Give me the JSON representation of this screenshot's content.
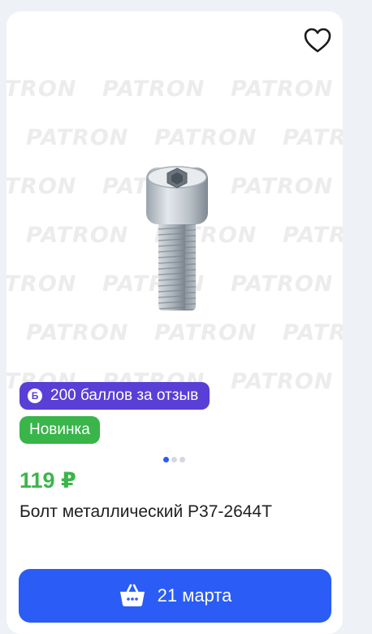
{
  "product": {
    "favorite_icon": "heart-outline-icon",
    "watermark": "PATRON",
    "image_icon": "hex-socket-bolt-image",
    "badges": {
      "points_icon_letter": "Б",
      "points_label": "200 баллов за отзыв",
      "new_label": "Новинка"
    },
    "gallery": {
      "slides": 3,
      "active": 1
    },
    "price": "119 ₽",
    "title": "Болт металлический P37-2644T",
    "buy_button": {
      "icon": "basket-icon",
      "label": "21 марта"
    },
    "colors": {
      "points_badge": "#5a3fd6",
      "new_badge": "#39b54a",
      "price": "#3bb54a",
      "button": "#2b5cf6"
    }
  }
}
